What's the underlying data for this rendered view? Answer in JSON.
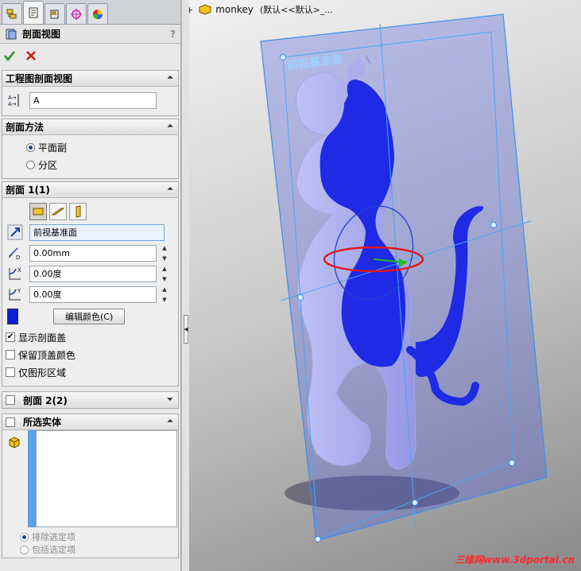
{
  "tabs": [
    {
      "icon": "feature-manager-icon"
    },
    {
      "icon": "property-manager-icon"
    },
    {
      "icon": "configuration-manager-icon"
    },
    {
      "icon": "dimxpert-icon"
    },
    {
      "icon": "display-manager-icon"
    }
  ],
  "pm": {
    "title": "剖面视图",
    "help": "?",
    "groups": {
      "drawing_view": {
        "title": "工程图剖面视图",
        "label_value": "A"
      },
      "method": {
        "title": "剖面方法",
        "option_planar": "平面副",
        "option_zonal": "分区",
        "selected": "平面副"
      },
      "section1": {
        "title": "剖面 1(1)",
        "reference_plane": "前视基准面",
        "distance": "0.00mm",
        "rot_x": "0.00度",
        "rot_y": "0.00度",
        "edit_color_button": "编辑颜色(C)",
        "show_cap": "显示剖面盖",
        "keep_top_color": "保留顶盖颜色",
        "graphics_only": "仅图形区域",
        "cap_color": "#0f1fd6"
      },
      "section2": {
        "title": "剖面 2(2)"
      },
      "selected_bodies": {
        "title": "所选实体",
        "exclude": "排除选定项",
        "include": "包括选定项"
      }
    }
  },
  "viewport": {
    "tree_root": "monkey",
    "tree_suffix": "(默认<<默认>_...",
    "plane_label": "前视基准面",
    "watermark": "三维网www.3dportal.cn"
  }
}
